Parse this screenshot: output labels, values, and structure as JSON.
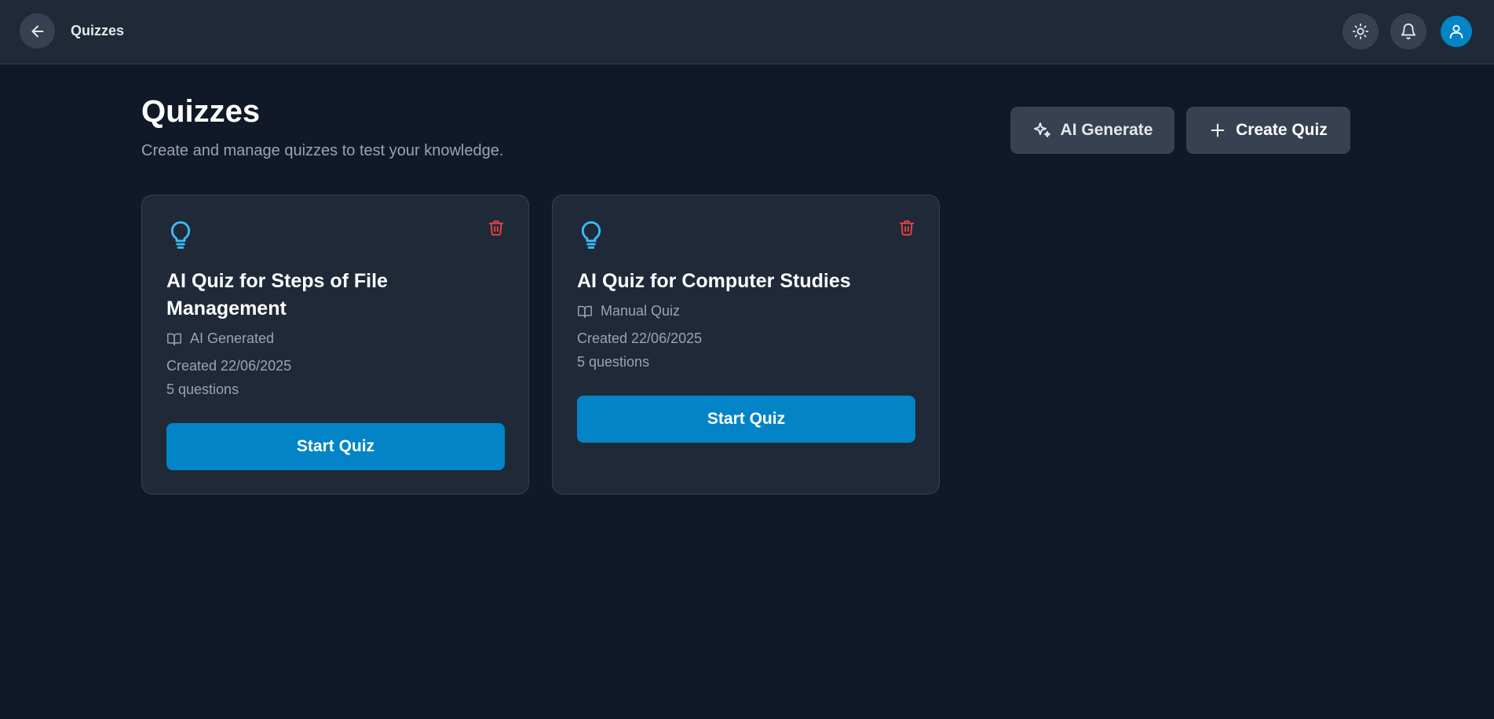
{
  "header": {
    "title": "Quizzes",
    "back_icon": "arrow-left-icon",
    "theme_icon": "sun-icon",
    "notifications_icon": "bell-icon",
    "avatar_icon": "user-icon"
  },
  "page": {
    "title": "Quizzes",
    "subtitle": "Create and manage quizzes to test your knowledge."
  },
  "actions": {
    "ai_generate_label": "AI Generate",
    "create_quiz_label": "Create Quiz"
  },
  "quizzes": [
    {
      "title": "AI Quiz for Steps of File Management",
      "type": "AI Generated",
      "created": "Created 22/06/2025",
      "questions": "5 questions",
      "start_label": "Start Quiz"
    },
    {
      "title": "AI Quiz for Computer Studies",
      "type": "Manual Quiz",
      "created": "Created 22/06/2025",
      "questions": "5 questions",
      "start_label": "Start Quiz"
    }
  ],
  "colors": {
    "background": "#111827",
    "surface": "#1f2937",
    "accent": "#0284c7",
    "icon_accent": "#38bdf8",
    "danger": "#ef4444"
  }
}
